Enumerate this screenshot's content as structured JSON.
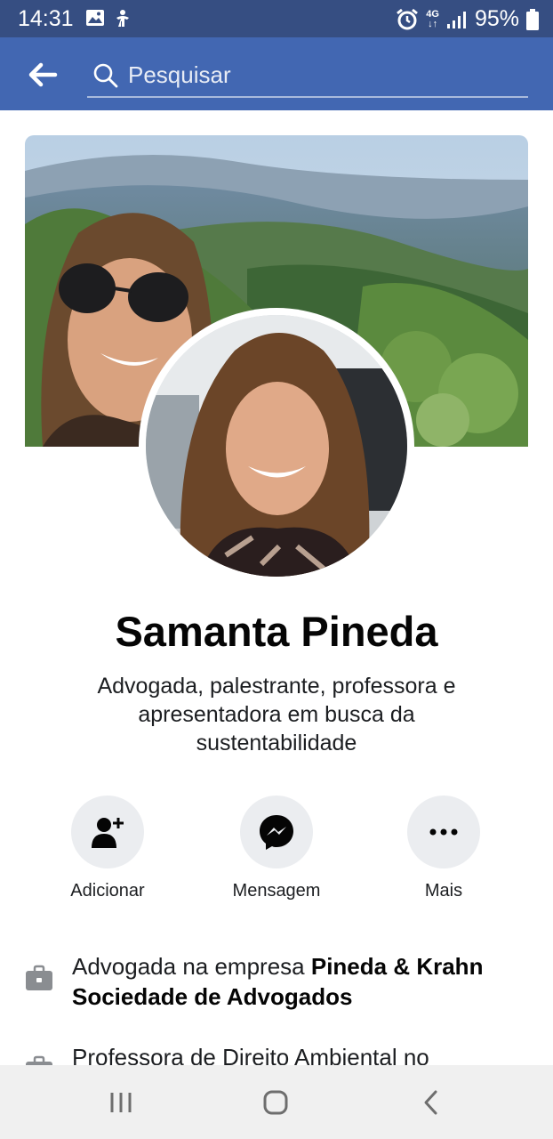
{
  "status": {
    "time": "14:31",
    "network_top": "4G",
    "network_bottom": "↓↑",
    "battery": "95%"
  },
  "search": {
    "placeholder": "Pesquisar"
  },
  "profile": {
    "name": "Samanta Pineda",
    "bio": "Advogada, palestrante, professora e apresentadora em busca da sustentabilidade"
  },
  "actions": [
    {
      "label": "Adicionar",
      "icon": "add-friend-icon"
    },
    {
      "label": "Mensagem",
      "icon": "messenger-icon"
    },
    {
      "label": "Mais",
      "icon": "more-icon"
    }
  ],
  "info": [
    {
      "prefix": "Advogada na empresa ",
      "strong": "Pineda & Krahn Sociedade de Advogados",
      "icon": "briefcase-icon"
    },
    {
      "prefix": "Professora de Direito Ambiental no",
      "strong": "",
      "icon": "briefcase-icon"
    }
  ],
  "colors": {
    "header": "#4267b2",
    "status_bar": "#364e82",
    "button_bg": "#ebedf0"
  }
}
